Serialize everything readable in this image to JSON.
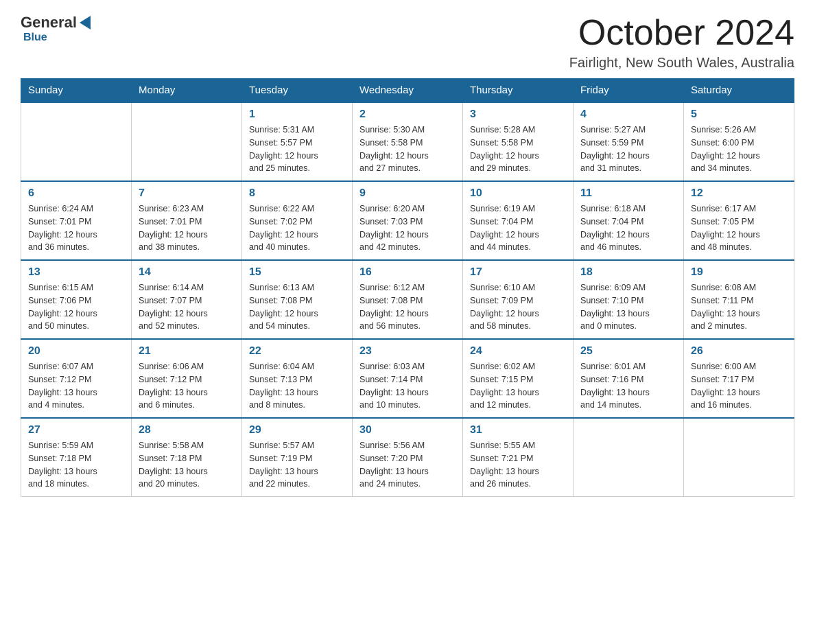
{
  "header": {
    "logo": {
      "general": "General",
      "blue": "Blue"
    },
    "title": "October 2024",
    "location": "Fairlight, New South Wales, Australia"
  },
  "weekdays": [
    "Sunday",
    "Monday",
    "Tuesday",
    "Wednesday",
    "Thursday",
    "Friday",
    "Saturday"
  ],
  "weeks": [
    [
      {
        "day": "",
        "info": ""
      },
      {
        "day": "",
        "info": ""
      },
      {
        "day": "1",
        "info": "Sunrise: 5:31 AM\nSunset: 5:57 PM\nDaylight: 12 hours\nand 25 minutes."
      },
      {
        "day": "2",
        "info": "Sunrise: 5:30 AM\nSunset: 5:58 PM\nDaylight: 12 hours\nand 27 minutes."
      },
      {
        "day": "3",
        "info": "Sunrise: 5:28 AM\nSunset: 5:58 PM\nDaylight: 12 hours\nand 29 minutes."
      },
      {
        "day": "4",
        "info": "Sunrise: 5:27 AM\nSunset: 5:59 PM\nDaylight: 12 hours\nand 31 minutes."
      },
      {
        "day": "5",
        "info": "Sunrise: 5:26 AM\nSunset: 6:00 PM\nDaylight: 12 hours\nand 34 minutes."
      }
    ],
    [
      {
        "day": "6",
        "info": "Sunrise: 6:24 AM\nSunset: 7:01 PM\nDaylight: 12 hours\nand 36 minutes."
      },
      {
        "day": "7",
        "info": "Sunrise: 6:23 AM\nSunset: 7:01 PM\nDaylight: 12 hours\nand 38 minutes."
      },
      {
        "day": "8",
        "info": "Sunrise: 6:22 AM\nSunset: 7:02 PM\nDaylight: 12 hours\nand 40 minutes."
      },
      {
        "day": "9",
        "info": "Sunrise: 6:20 AM\nSunset: 7:03 PM\nDaylight: 12 hours\nand 42 minutes."
      },
      {
        "day": "10",
        "info": "Sunrise: 6:19 AM\nSunset: 7:04 PM\nDaylight: 12 hours\nand 44 minutes."
      },
      {
        "day": "11",
        "info": "Sunrise: 6:18 AM\nSunset: 7:04 PM\nDaylight: 12 hours\nand 46 minutes."
      },
      {
        "day": "12",
        "info": "Sunrise: 6:17 AM\nSunset: 7:05 PM\nDaylight: 12 hours\nand 48 minutes."
      }
    ],
    [
      {
        "day": "13",
        "info": "Sunrise: 6:15 AM\nSunset: 7:06 PM\nDaylight: 12 hours\nand 50 minutes."
      },
      {
        "day": "14",
        "info": "Sunrise: 6:14 AM\nSunset: 7:07 PM\nDaylight: 12 hours\nand 52 minutes."
      },
      {
        "day": "15",
        "info": "Sunrise: 6:13 AM\nSunset: 7:08 PM\nDaylight: 12 hours\nand 54 minutes."
      },
      {
        "day": "16",
        "info": "Sunrise: 6:12 AM\nSunset: 7:08 PM\nDaylight: 12 hours\nand 56 minutes."
      },
      {
        "day": "17",
        "info": "Sunrise: 6:10 AM\nSunset: 7:09 PM\nDaylight: 12 hours\nand 58 minutes."
      },
      {
        "day": "18",
        "info": "Sunrise: 6:09 AM\nSunset: 7:10 PM\nDaylight: 13 hours\nand 0 minutes."
      },
      {
        "day": "19",
        "info": "Sunrise: 6:08 AM\nSunset: 7:11 PM\nDaylight: 13 hours\nand 2 minutes."
      }
    ],
    [
      {
        "day": "20",
        "info": "Sunrise: 6:07 AM\nSunset: 7:12 PM\nDaylight: 13 hours\nand 4 minutes."
      },
      {
        "day": "21",
        "info": "Sunrise: 6:06 AM\nSunset: 7:12 PM\nDaylight: 13 hours\nand 6 minutes."
      },
      {
        "day": "22",
        "info": "Sunrise: 6:04 AM\nSunset: 7:13 PM\nDaylight: 13 hours\nand 8 minutes."
      },
      {
        "day": "23",
        "info": "Sunrise: 6:03 AM\nSunset: 7:14 PM\nDaylight: 13 hours\nand 10 minutes."
      },
      {
        "day": "24",
        "info": "Sunrise: 6:02 AM\nSunset: 7:15 PM\nDaylight: 13 hours\nand 12 minutes."
      },
      {
        "day": "25",
        "info": "Sunrise: 6:01 AM\nSunset: 7:16 PM\nDaylight: 13 hours\nand 14 minutes."
      },
      {
        "day": "26",
        "info": "Sunrise: 6:00 AM\nSunset: 7:17 PM\nDaylight: 13 hours\nand 16 minutes."
      }
    ],
    [
      {
        "day": "27",
        "info": "Sunrise: 5:59 AM\nSunset: 7:18 PM\nDaylight: 13 hours\nand 18 minutes."
      },
      {
        "day": "28",
        "info": "Sunrise: 5:58 AM\nSunset: 7:18 PM\nDaylight: 13 hours\nand 20 minutes."
      },
      {
        "day": "29",
        "info": "Sunrise: 5:57 AM\nSunset: 7:19 PM\nDaylight: 13 hours\nand 22 minutes."
      },
      {
        "day": "30",
        "info": "Sunrise: 5:56 AM\nSunset: 7:20 PM\nDaylight: 13 hours\nand 24 minutes."
      },
      {
        "day": "31",
        "info": "Sunrise: 5:55 AM\nSunset: 7:21 PM\nDaylight: 13 hours\nand 26 minutes."
      },
      {
        "day": "",
        "info": ""
      },
      {
        "day": "",
        "info": ""
      }
    ]
  ]
}
